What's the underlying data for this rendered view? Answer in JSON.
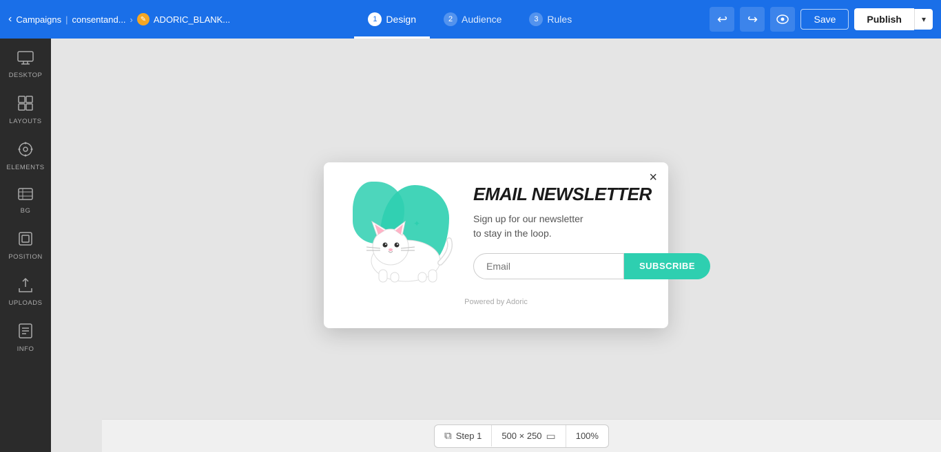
{
  "topbar": {
    "back_icon": "‹",
    "campaigns_label": "Campaigns",
    "breadcrumb_separator": "|",
    "breadcrumb_site": "consentand...",
    "breadcrumb_arrow": "›",
    "campaign_name": "ADORIC_BLANK...",
    "tabs": [
      {
        "num": "1",
        "label": "Design",
        "active": true
      },
      {
        "num": "2",
        "label": "Audience",
        "active": false
      },
      {
        "num": "3",
        "label": "Rules",
        "active": false
      }
    ],
    "undo_icon": "↩",
    "redo_icon": "↪",
    "preview_icon": "👁",
    "save_label": "Save",
    "publish_label": "Publish",
    "dropdown_icon": "▾"
  },
  "sidebar": {
    "items": [
      {
        "id": "desktop",
        "icon": "🖥",
        "label": "DESKTOP"
      },
      {
        "id": "layouts",
        "icon": "⊞",
        "label": "LAYOUTS"
      },
      {
        "id": "elements",
        "icon": "⬡",
        "label": "ELEMENTS"
      },
      {
        "id": "bg",
        "icon": "▤",
        "label": "BG"
      },
      {
        "id": "position",
        "icon": "⊡",
        "label": "POSITION"
      },
      {
        "id": "uploads",
        "icon": "⬆",
        "label": "UPLOADS"
      },
      {
        "id": "info",
        "icon": "⌨",
        "label": "INFO"
      }
    ]
  },
  "popup": {
    "close_icon": "×",
    "title": "EMAIL NEWSLETTER",
    "subtitle": "Sign up for our newsletter\nto stay in the loop.",
    "email_placeholder": "Email",
    "subscribe_label": "SUBSCRIBE",
    "powered_by": "Powered by Adoric"
  },
  "bottom_bar": {
    "step_icon": "⧉",
    "step_label": "Step 1",
    "dimensions": "500 × 250",
    "screen_icon": "▭",
    "zoom": "100%"
  }
}
